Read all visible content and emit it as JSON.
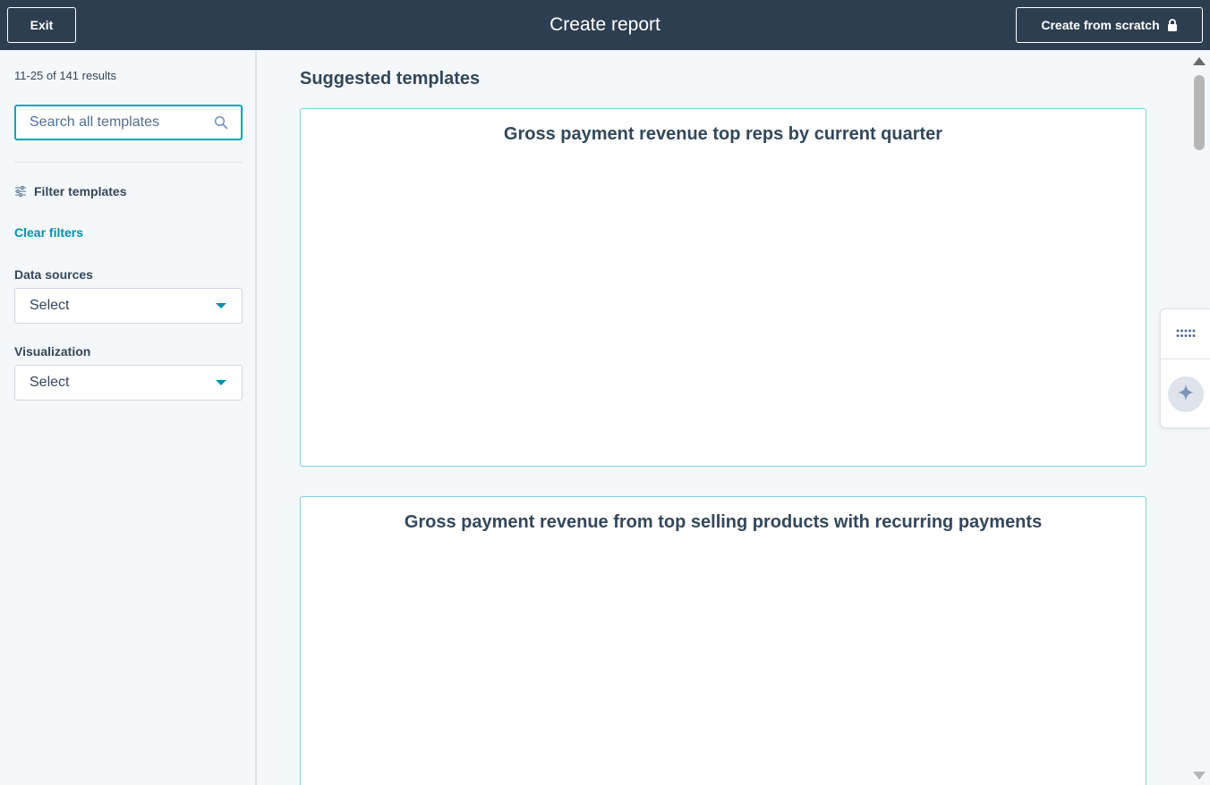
{
  "header": {
    "exit_label": "Exit",
    "title": "Create report",
    "create_scratch_label": "Create from scratch"
  },
  "sidebar": {
    "results_count": "11-25 of 141 results",
    "search": {
      "placeholder": "Search all templates",
      "value": ""
    },
    "filter_title": "Filter templates",
    "clear_filters_label": "Clear filters",
    "data_sources": {
      "label": "Data sources",
      "selected": "Select"
    },
    "visualization": {
      "label": "Visualization",
      "selected": "Select"
    }
  },
  "main": {
    "section_title": "Suggested templates",
    "templates": [
      {
        "title": "Gross payment revenue top reps by current quarter"
      },
      {
        "title": "Gross payment revenue from top selling products with recurring payments"
      }
    ]
  },
  "icons": {
    "lock": "lock-icon",
    "search": "search-icon",
    "filter": "sliders-icon",
    "caret": "caret-down-icon",
    "grid": "grid-dots-icon",
    "ai": "sparkle-icon"
  },
  "colors": {
    "header_bg": "#2d3e50",
    "accent": "#00a4bd",
    "link": "#0091ae",
    "text": "#33475b",
    "page_bg": "#f5f8fa"
  }
}
